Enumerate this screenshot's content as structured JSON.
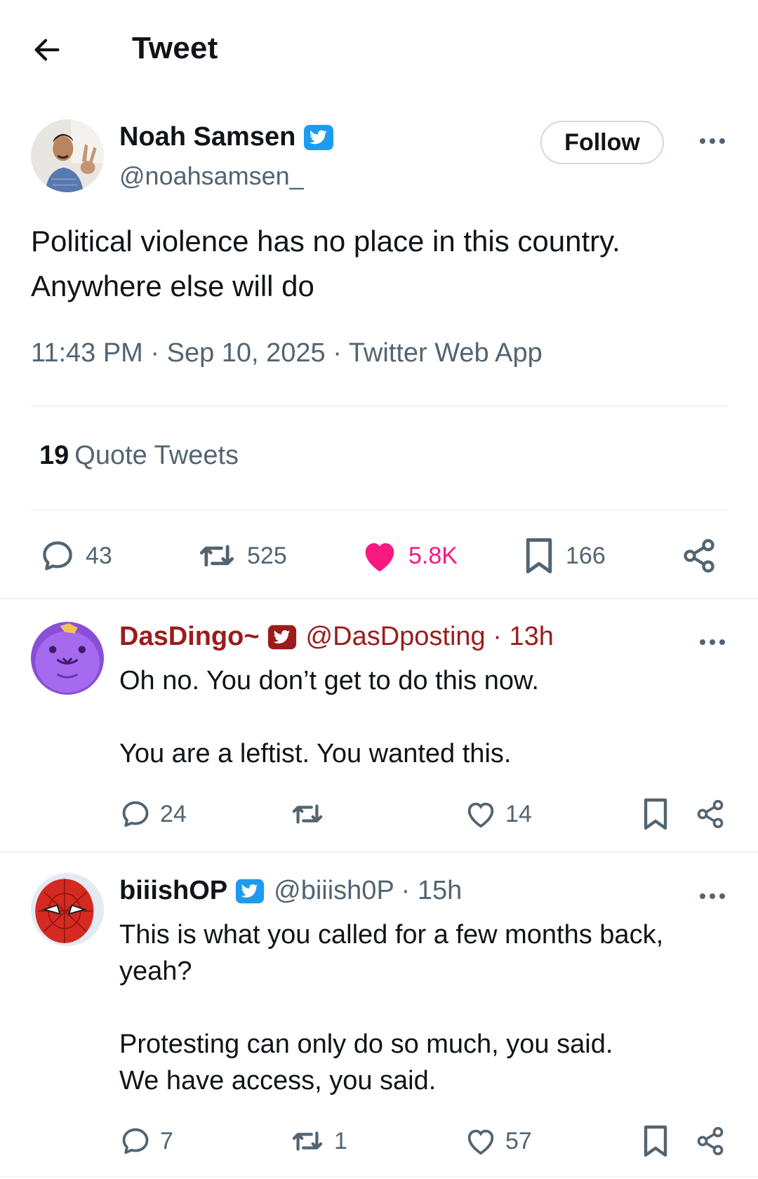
{
  "header": {
    "title": "Tweet"
  },
  "tweet": {
    "author_name": "Noah Samsen",
    "author_handle": "@noahsamsen_",
    "follow_label": "Follow",
    "text_line1": "Political violence has no place in this country.",
    "text_line2": "Anywhere else will do",
    "meta": "11:43 PM · Sep 10, 2025 · Twitter Web App",
    "quote_count": "19",
    "quote_label": "Quote Tweets",
    "stats": {
      "replies": "43",
      "retweets": "525",
      "likes": "5.8K",
      "bookmarks": "166"
    }
  },
  "replies": [
    {
      "name": "DasDingo~",
      "handle_time": "@DasDposting · 13h",
      "name_color": "#9b1c1c",
      "lines": [
        "Oh no. You don’t get to do this now.",
        "You are a leftist. You wanted this."
      ],
      "stats": {
        "replies": "24",
        "retweets": "",
        "likes": "14"
      }
    },
    {
      "name": "biiishOP",
      "handle_time": "@biiish0P · 15h",
      "name_color": "#0f1419",
      "lines": [
        "This is what you called for a few months back,",
        "yeah?",
        "Protesting can only do so much, you said.",
        "We have access, you said."
      ],
      "stats": {
        "replies": "7",
        "retweets": "1",
        "likes": "57"
      }
    }
  ],
  "colors": {
    "like_pink": "#f91880",
    "verified_blue": "#1d9bf0",
    "muted": "#536471"
  }
}
